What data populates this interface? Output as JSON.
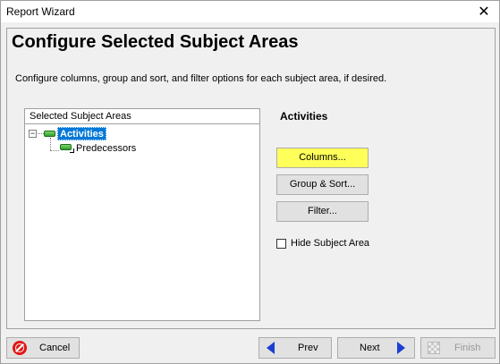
{
  "window": {
    "title": "Report Wizard",
    "close_glyph": "✕"
  },
  "page": {
    "title": "Configure Selected Subject Areas",
    "description": "Configure columns, group and sort, and filter options for each subject area, if desired."
  },
  "tree": {
    "header": "Selected Subject Areas",
    "expander_glyph": "−",
    "root": "Activities",
    "child": "Predecessors"
  },
  "details": {
    "title": "Activities",
    "columns_label": "Columns...",
    "group_sort_label": "Group & Sort...",
    "filter_label": "Filter...",
    "hide_label": "Hide Subject Area",
    "hide_checked": false,
    "highlight_color": "#ffff5a"
  },
  "footer": {
    "cancel_label": "Cancel",
    "prev_label": "Prev",
    "next_label": "Next",
    "finish_label": "Finish"
  },
  "colors": {
    "selection": "#0078d7",
    "nav_arrow": "#1c3fd1",
    "cancel_icon": "#e01515"
  }
}
